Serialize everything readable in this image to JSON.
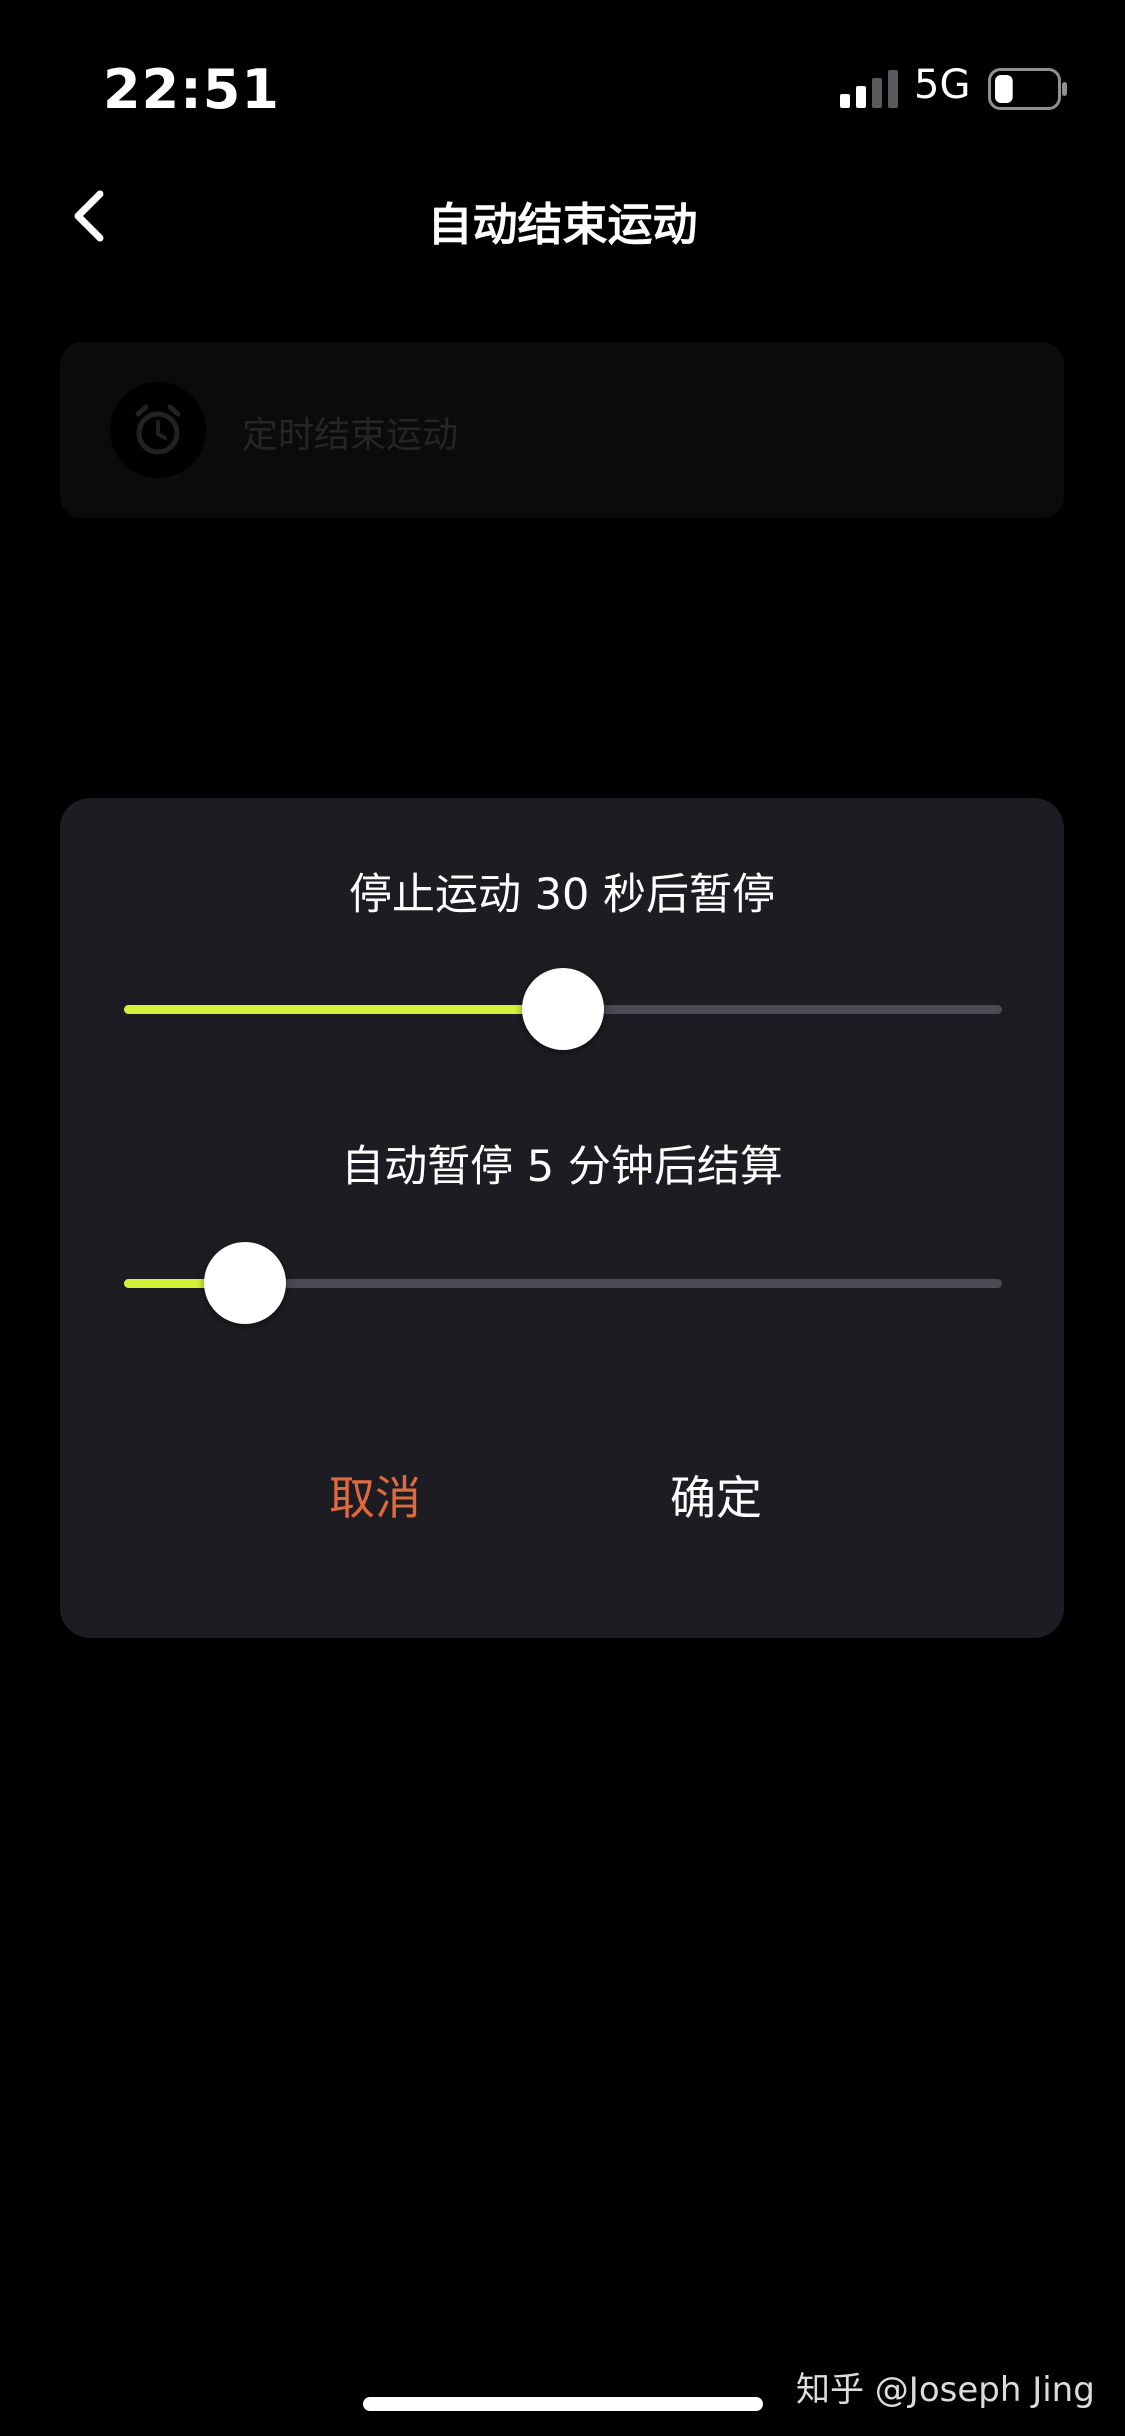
{
  "status_bar": {
    "time": "22:51",
    "network": "5G",
    "signal_icon": "cellular-signal-icon",
    "battery_icon": "battery-icon",
    "battery_level": 0.3
  },
  "nav": {
    "back_icon": "chevron-left-icon",
    "title": "自动结束运动"
  },
  "background_row": {
    "icon": "alarm-clock-icon",
    "label": "定时结束运动"
  },
  "dialog": {
    "slider1": {
      "label": "停止运动 30 秒后暂停",
      "value_fraction": 0.5
    },
    "slider2": {
      "label": "自动暂停 5 分钟后结算",
      "value_fraction": 0.1
    },
    "cancel_label": "取消",
    "confirm_label": "确定"
  },
  "watermark": "知乎 @Joseph Jing",
  "colors": {
    "accent": "#d4f23a",
    "cancel": "#e0693f",
    "dialog_bg": "#1c1c22",
    "track": "#4a4a52"
  }
}
